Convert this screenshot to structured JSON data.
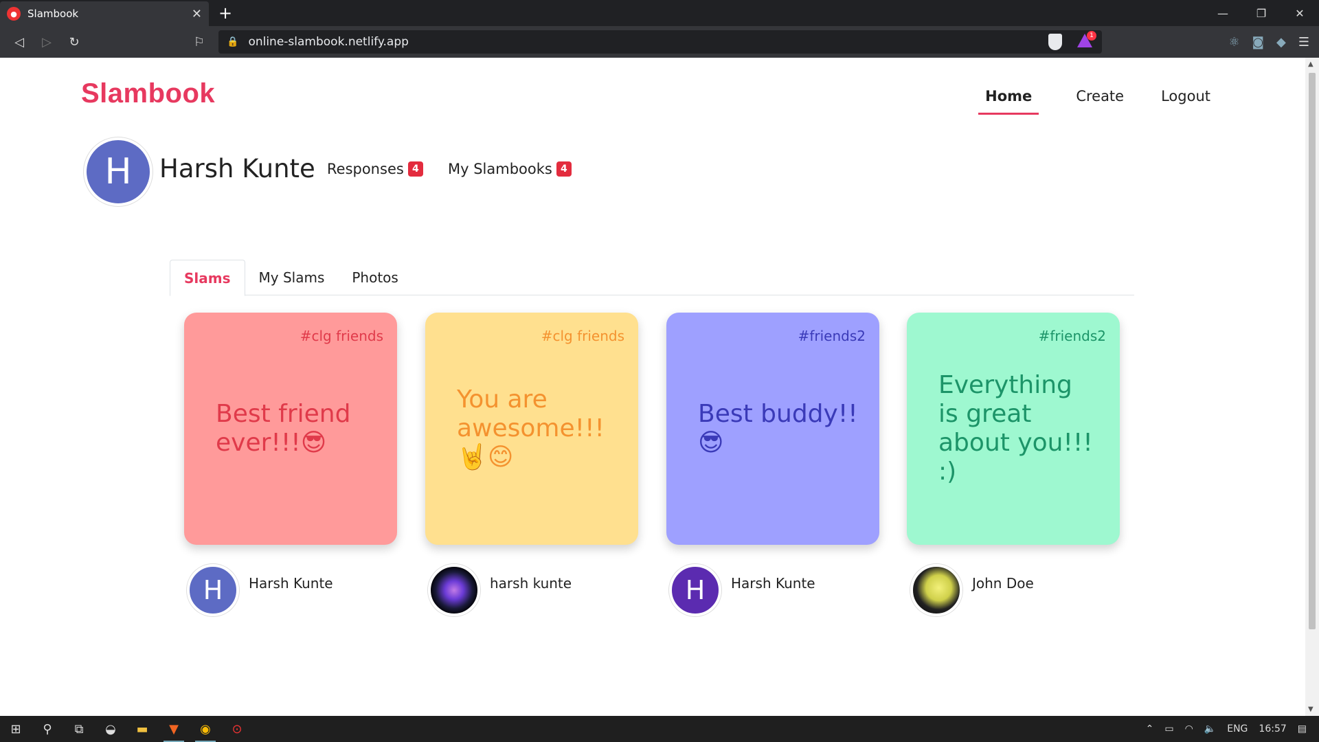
{
  "browser": {
    "tab_title": "Slambook",
    "url": "online-slambook.netlify.app",
    "rewards_badge": "1"
  },
  "site": {
    "brand": "Slambook",
    "nav": [
      {
        "label": "Home",
        "active": true
      },
      {
        "label": "Create",
        "active": false
      },
      {
        "label": "Logout",
        "active": false
      }
    ]
  },
  "profile": {
    "avatar_letter": "H",
    "name": "Harsh Kunte",
    "responses_label": "Responses",
    "responses_count": "4",
    "slambooks_label": "My Slambooks",
    "slambooks_count": "4"
  },
  "tabs": [
    {
      "label": "Slams",
      "active": true
    },
    {
      "label": "My Slams",
      "active": false
    },
    {
      "label": "Photos",
      "active": false
    }
  ],
  "cards": [
    {
      "tag": "#clg friends",
      "message": "Best friend ever!!!😎",
      "bg": "#ff9a9a",
      "fg": "#e03a4a",
      "author": "Harsh Kunte",
      "author_avatar": "H",
      "avatar_bg": "#5d6bc4"
    },
    {
      "tag": "#clg friends",
      "message": "You are awesome!!! 🤘😊",
      "bg": "#ffe08f",
      "fg": "#f4922f",
      "author": "harsh kunte",
      "author_avatar": "",
      "avatar_bg": "#0a0a14"
    },
    {
      "tag": "#friends2",
      "message": "Best buddy!! 😎",
      "bg": "#9ea0ff",
      "fg": "#3a3ab8",
      "author": "Harsh Kunte",
      "author_avatar": "H",
      "avatar_bg": "#5b2bb0"
    },
    {
      "tag": "#friends2",
      "message": "Everything is great about you!!! :)",
      "bg": "#9ef8d0",
      "fg": "#1c9468",
      "author": "John Doe",
      "author_avatar": "",
      "avatar_bg": "#111"
    }
  ],
  "taskbar": {
    "language": "ENG",
    "time": "16:57"
  },
  "colors": {
    "accent": "#e7395f",
    "badge": "#e32c3e"
  }
}
